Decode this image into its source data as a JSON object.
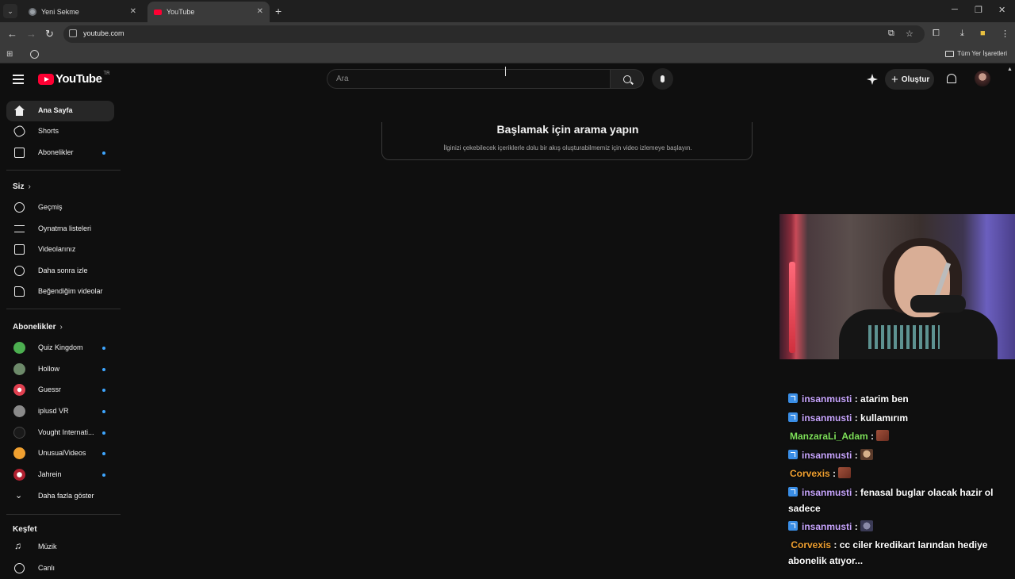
{
  "browser": {
    "tabs": [
      {
        "title": "Yeni Sekme",
        "active": false
      },
      {
        "title": "YouTube",
        "active": true
      }
    ],
    "url": "youtube.com",
    "bookmarks_all": "Tüm Yer İşaretleri"
  },
  "header": {
    "logo_text": "YouTube",
    "country": "TR",
    "search_placeholder": "Ara",
    "create_label": "Oluştur"
  },
  "sidebar": {
    "main": [
      {
        "label": "Ana Sayfa",
        "icon": "home-icon",
        "active": true
      },
      {
        "label": "Shorts",
        "icon": "shorts-icon"
      },
      {
        "label": "Abonelikler",
        "icon": "subscriptions-icon",
        "dot": true
      }
    ],
    "you_heading": "Siz",
    "you": [
      {
        "label": "Geçmiş",
        "icon": "history-icon"
      },
      {
        "label": "Oynatma listeleri",
        "icon": "playlists-icon"
      },
      {
        "label": "Videolarınız",
        "icon": "your-videos-icon"
      },
      {
        "label": "Daha sonra izle",
        "icon": "watch-later-icon"
      },
      {
        "label": "Beğendiğim videolar",
        "icon": "liked-icon"
      }
    ],
    "subs_heading": "Abonelikler",
    "subs": [
      {
        "label": "Quiz Kingdom",
        "color": "#4caf50"
      },
      {
        "label": "Hollow",
        "color": "#6d8a6a"
      },
      {
        "label": "Guessr",
        "color": "#e04050"
      },
      {
        "label": "iplusd VR",
        "color": "#8a8a8a"
      },
      {
        "label": "Vought Internati...",
        "color": "#1a1a1a"
      },
      {
        "label": "UnusualVideos",
        "color": "#f0a030"
      },
      {
        "label": "Jahrein",
        "color": "#b02030"
      }
    ],
    "show_more": "Daha fazla göster",
    "explore_heading": "Keşfet",
    "explore": [
      {
        "label": "Müzik",
        "icon": "music-icon"
      },
      {
        "label": "Canlı",
        "icon": "live-icon"
      }
    ]
  },
  "main": {
    "prompt_title": "Başlamak için arama yapın",
    "prompt_subtitle": "İlginizi çekebilecek içeriklerle dolu bir akış oluşturabilmemiz için video izlemeye başlayın."
  },
  "chat": [
    {
      "user": "insanmusti",
      "msg": ": atarim ben"
    },
    {
      "user": "insanmusti",
      "msg": ": kullamırım"
    },
    {
      "user": "ManzaraLi_Adam",
      "msg": ":"
    },
    {
      "user": "insanmusti",
      "msg": ":"
    },
    {
      "user": "Corvexis",
      "msg": ":"
    },
    {
      "user": "insanmusti",
      "msg": ": fenasal buglar olacak hazir ol sadece"
    },
    {
      "user": "insanmusti",
      "msg": ":"
    },
    {
      "user": "Corvexis",
      "msg": ": cc ciler kredikart larından hediye abonelik atıyor..."
    }
  ]
}
